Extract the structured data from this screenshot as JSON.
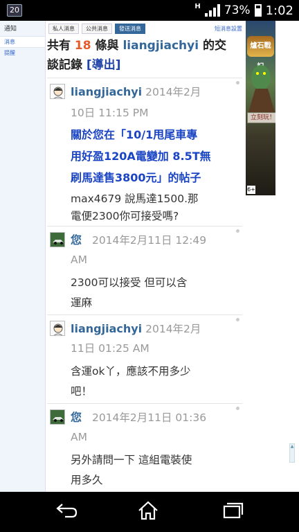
{
  "status_bar": {
    "date_badge": "20",
    "network": "H",
    "battery_percent": "73%",
    "time": "1:02"
  },
  "left_nav": {
    "top_label": "通知",
    "items": [
      "消息",
      "提醒"
    ]
  },
  "tabs": {
    "items": [
      "私人消息",
      "公共消息",
      "發送消息"
    ],
    "active_index": 2,
    "right_link": "短消息設置"
  },
  "heading": {
    "prefix": "共有",
    "count": "18",
    "middle": "條與",
    "user": "liangjiachyi",
    "suffix_line1": "的交",
    "suffix_line2": "談記錄",
    "export_label": "[導出]"
  },
  "messages": [
    {
      "author": "liangjiachyi",
      "time_line1": "2014年2月",
      "time_line2": "10日 11:15 PM",
      "link_lines": [
        "關於您在「10/1甩尾車專",
        "用好盈120A電變加 8.5T無",
        "刷馬達售3800元」的帖子"
      ],
      "body_lines": [
        "max4679  說馬達1500.那",
        "電便2300你可接受嗎?"
      ]
    },
    {
      "author": "您",
      "time_line1": "2014年2月11日 12:49",
      "time_line2": "AM",
      "body_lines": [
        "2300可以接受  但可以含",
        "運麻"
      ]
    },
    {
      "author": "liangjiachyi",
      "time_line1": "2014年2月",
      "time_line2": "11日 01:25 AM",
      "body_lines": [
        "含運ok丫，應該不用多少",
        "吧！"
      ]
    },
    {
      "author": "您",
      "time_line1": "2014年2月11日 01:36",
      "time_line2": "AM",
      "body_lines": [
        "另外請問一下  這組電裝使",
        "用多久"
      ]
    }
  ],
  "ad": {
    "title": "爐石戰記",
    "cta": "立刻玩！",
    "rating": "6+"
  },
  "nav_bar": {
    "back": "back-icon",
    "home": "home-icon",
    "recents": "recents-icon"
  }
}
